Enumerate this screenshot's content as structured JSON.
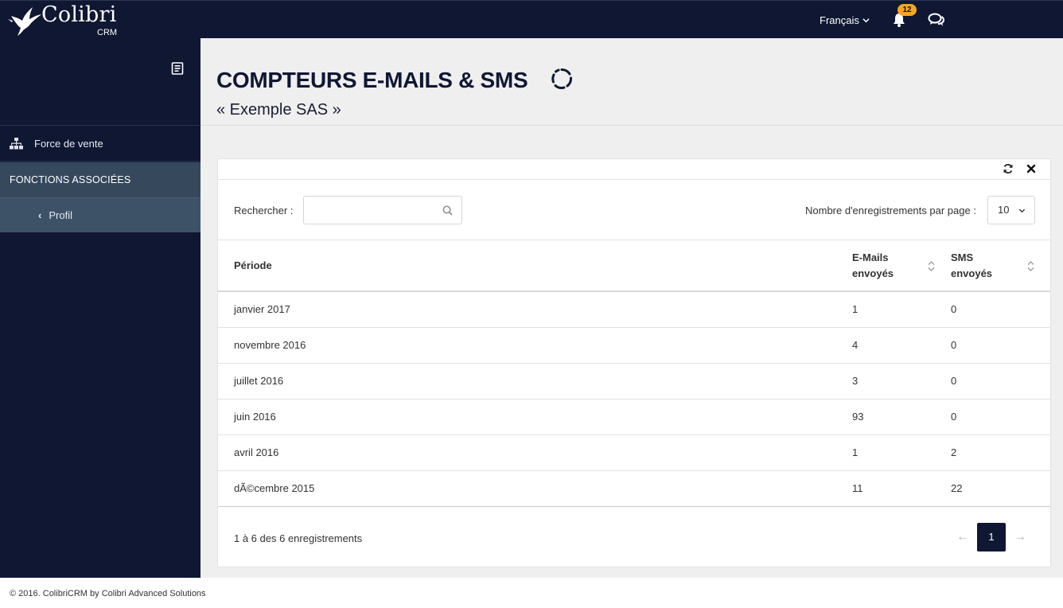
{
  "app": {
    "brand": "Colibri",
    "brand_sub": "CRM"
  },
  "topbar": {
    "language": "Français",
    "notification_count": "12"
  },
  "sidebar": {
    "items": [
      {
        "label": "Force de vente",
        "icon": "sitemap-icon"
      }
    ],
    "section_label": "FONCTIONS ASSOCIÉES",
    "sub_items": [
      {
        "label": "Profil",
        "icon": "chevron-left-icon"
      }
    ]
  },
  "page": {
    "title": "COMPTEURS E-MAILS & SMS",
    "subtitle": "« Exemple SAS »"
  },
  "table": {
    "search_label": "Rechercher :",
    "search_value": "",
    "per_page_label": "Nombre d'enregistrements par page :",
    "per_page_value": "10",
    "columns": [
      {
        "label": "Période"
      },
      {
        "label": "E-Mails envoyés"
      },
      {
        "label": "SMS envoyés"
      }
    ],
    "rows": [
      {
        "period": "janvier 2017",
        "emails": "1",
        "sms": "0"
      },
      {
        "period": "novembre 2016",
        "emails": "4",
        "sms": "0"
      },
      {
        "period": "juillet 2016",
        "emails": "3",
        "sms": "0"
      },
      {
        "period": "juin 2016",
        "emails": "93",
        "sms": "0"
      },
      {
        "period": "avril 2016",
        "emails": "1",
        "sms": "2"
      },
      {
        "period": "dÃ©cembre 2015",
        "emails": "11",
        "sms": "22"
      }
    ],
    "info": "1 à 6 des 6 enregistrements",
    "pager": {
      "prev": "←",
      "current": "1",
      "next": "→"
    }
  },
  "footer": {
    "text": "© 2016. ColibriCRM by Colibri Advanced Solutions"
  },
  "colors": {
    "navy": "#0f1733",
    "badge": "#f5a623",
    "section": "#35485c",
    "sub_item": "#3d5266"
  }
}
